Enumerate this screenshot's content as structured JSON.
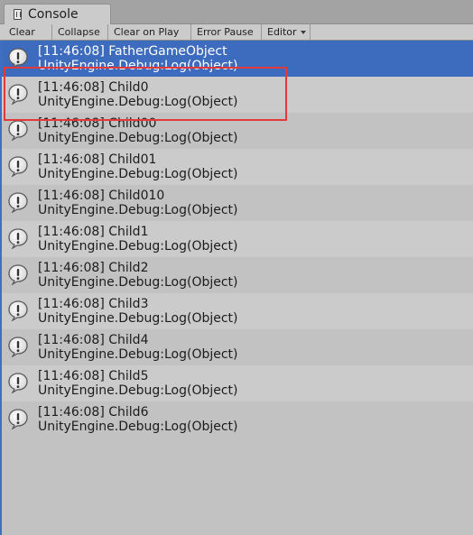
{
  "window": {
    "tab_title": "Console",
    "tab_icon": "console-icon"
  },
  "toolbar": {
    "buttons": [
      {
        "label": "Clear"
      },
      {
        "label": "Collapse"
      },
      {
        "label": "Clear on Play"
      },
      {
        "label": "Error Pause"
      },
      {
        "label": "Editor"
      }
    ],
    "dropdown_icon": "chevron-down-icon"
  },
  "log": {
    "entry_icon": "info-bubble-icon",
    "entries": [
      {
        "message": "[11:46:08] FatherGameObject",
        "stack": "UnityEngine.Debug:Log(Object)",
        "selected": true
      },
      {
        "message": "[11:46:08] Child0",
        "stack": "UnityEngine.Debug:Log(Object)"
      },
      {
        "message": "[11:46:08] Child00",
        "stack": "UnityEngine.Debug:Log(Object)"
      },
      {
        "message": "[11:46:08] Child01",
        "stack": "UnityEngine.Debug:Log(Object)"
      },
      {
        "message": "[11:46:08] Child010",
        "stack": "UnityEngine.Debug:Log(Object)"
      },
      {
        "message": "[11:46:08] Child1",
        "stack": "UnityEngine.Debug:Log(Object)"
      },
      {
        "message": "[11:46:08] Child2",
        "stack": "UnityEngine.Debug:Log(Object)"
      },
      {
        "message": "[11:46:08] Child3",
        "stack": "UnityEngine.Debug:Log(Object)"
      },
      {
        "message": "[11:46:08] Child4",
        "stack": "UnityEngine.Debug:Log(Object)"
      },
      {
        "message": "[11:46:08] Child5",
        "stack": "UnityEngine.Debug:Log(Object)"
      },
      {
        "message": "[11:46:08] Child6",
        "stack": "UnityEngine.Debug:Log(Object)"
      }
    ]
  },
  "colors": {
    "selection": "#3d6bbd",
    "highlight_box": "#e23a3a"
  }
}
